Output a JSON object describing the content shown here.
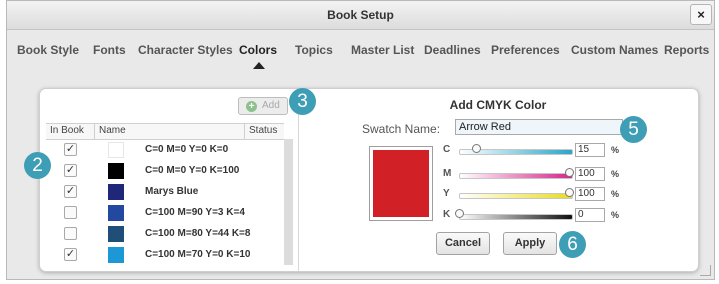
{
  "window": {
    "title": "Book Setup",
    "close_label": "×"
  },
  "tabs": [
    {
      "label": "Book Style"
    },
    {
      "label": "Fonts"
    },
    {
      "label": "Character Styles"
    },
    {
      "label": "Colors",
      "active": true
    },
    {
      "label": "Topics"
    },
    {
      "label": "Master List"
    },
    {
      "label": "Deadlines"
    },
    {
      "label": "Preferences"
    },
    {
      "label": "Custom Names"
    },
    {
      "label": "Reports"
    }
  ],
  "color_list": {
    "add_label": "Add",
    "add_icon": "plus-circle-icon",
    "columns": {
      "in_book": "In Book",
      "name": "Name",
      "status": "Status"
    },
    "rows": [
      {
        "checked": true,
        "check_mark": "✓",
        "swatch": "#ffffff",
        "name": "C=0 M=0 Y=0 K=0"
      },
      {
        "checked": true,
        "check_mark": "✓",
        "swatch": "#000000",
        "name": "C=0 M=0 Y=0 K=100"
      },
      {
        "checked": true,
        "check_mark": "✓",
        "swatch": "#1e2778",
        "name": "Marys Blue"
      },
      {
        "checked": false,
        "check_mark": "",
        "swatch": "#2348a0",
        "name": "C=100 M=90 Y=3 K=4"
      },
      {
        "checked": false,
        "check_mark": "",
        "swatch": "#1f4f79",
        "name": "C=100 M=80 Y=44 K=8"
      },
      {
        "checked": true,
        "check_mark": "✓",
        "swatch": "#1d97d6",
        "name": "C=100 M=70 Y=0 K=10"
      }
    ]
  },
  "cmyk_editor": {
    "title": "Add CMYK Color",
    "swatch_name_label": "Swatch Name:",
    "swatch_name_value": "Arrow Red",
    "preview_color": "#d12127",
    "channels": [
      {
        "label": "C",
        "value": "15",
        "unit": "%",
        "fraction": 0.15,
        "track_color": "#2aa6c8"
      },
      {
        "label": "M",
        "value": "100",
        "unit": "%",
        "fraction": 1.0,
        "track_color": "#d6248c"
      },
      {
        "label": "Y",
        "value": "100",
        "unit": "%",
        "fraction": 1.0,
        "track_color": "#e8dc1c"
      },
      {
        "label": "K",
        "value": "0",
        "unit": "%",
        "fraction": 0.0,
        "track_color": "#111111"
      }
    ],
    "cancel_label": "Cancel",
    "apply_label": "Apply"
  },
  "callouts": {
    "c2": "2",
    "c3": "3",
    "c5": "5",
    "c6": "6"
  },
  "colors": {
    "callout": "#3e9eb5"
  }
}
